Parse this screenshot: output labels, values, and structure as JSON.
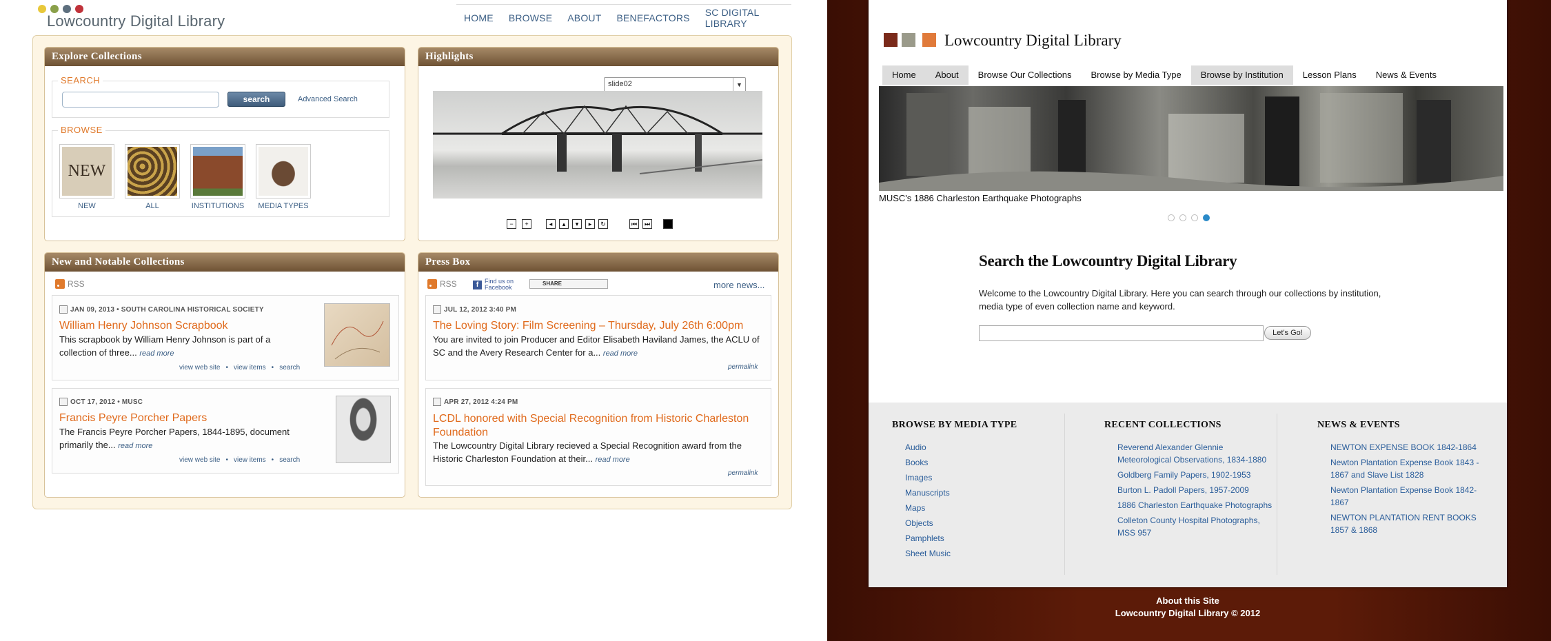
{
  "left": {
    "site_title": "Lowcountry Digital Library",
    "nav": [
      "HOME",
      "BROWSE",
      "ABOUT",
      "BENEFACTORS",
      "SC DIGITAL LIBRARY"
    ],
    "explore": {
      "heading": "Explore Collections",
      "search_label": "SEARCH",
      "search_button": "search",
      "advanced": "Advanced Search",
      "browse_label": "BROWSE",
      "thumbs": [
        "NEW",
        "ALL",
        "INSTITUTIONS",
        "MEDIA TYPES"
      ],
      "new_text": "NEW"
    },
    "highlights": {
      "heading": "Highlights",
      "slide_value": "slide02"
    },
    "notable": {
      "heading": "New and Notable Collections",
      "rss": "RSS",
      "items": [
        {
          "meta": "JAN 09, 2013 • SOUTH CAROLINA HISTORICAL SOCIETY",
          "title": "William Henry Johnson Scrapbook",
          "text": "This scrapbook by William Henry Johnson is part of a collection of three...",
          "read_more": "read more",
          "links": [
            "view web site",
            "view items",
            "search"
          ]
        },
        {
          "meta": "OCT 17, 2012 • MUSC",
          "title": "Francis Peyre Porcher Papers",
          "text": "The Francis Peyre Porcher Papers, 1844-1895, document primarily the...",
          "read_more": "read more",
          "links": [
            "view web site",
            "view items",
            "search"
          ]
        }
      ]
    },
    "press": {
      "heading": "Press Box",
      "rss": "RSS",
      "facebook": "Find us on Facebook",
      "share": "SHARE",
      "more_news": "more news...",
      "items": [
        {
          "meta": "JUL 12, 2012 3:40 PM",
          "title": "The Loving Story: Film Screening – Thursday, July 26th 6:00pm",
          "text": "You are invited to join Producer and Editor Elisabeth Haviland James, the ACLU of SC and the Avery Research Center for a...",
          "read_more": "read more",
          "permalink": "permalink"
        },
        {
          "meta": "APR 27, 2012 4:24 PM",
          "title": "LCDL honored with Special Recognition from Historic Charleston Foundation",
          "text": "The Lowcountry Digital Library recieved a Special Recognition award from the Historic Charleston Foundation at their...",
          "read_more": "read more",
          "permalink": "permalink"
        }
      ]
    }
  },
  "right": {
    "site_title": "Lowcountry Digital Library",
    "nav": [
      "Home",
      "About",
      "Browse Our Collections",
      "Browse by Media Type",
      "Browse by Institution",
      "Lesson Plans",
      "News & Events"
    ],
    "caption": "MUSC's 1886 Charleston Earthquake Photographs",
    "search_heading": "Search the Lowcountry Digital Library",
    "search_desc": "Welcome to the Lowcountry Digital Library.  Here you can search through our collections by institution, media type of even collection name and keyword.",
    "go_button": "Let's Go!",
    "footer": {
      "media": {
        "heading": "BROWSE BY MEDIA TYPE",
        "items": [
          "Audio",
          "Books",
          "Images",
          "Manuscripts",
          "Maps",
          "Objects",
          "Pamphlets",
          "Sheet Music"
        ]
      },
      "recent": {
        "heading": "RECENT COLLECTIONS",
        "items": [
          "Reverend Alexander Glennie Meteorological Observations, 1834-1880",
          "Goldberg Family Papers, 1902-1953",
          "Burton L. Padoll Papers, 1957-2009",
          "1886 Charleston Earthquake Photographs",
          "Colleton County Hospital Photographs, MSS 957"
        ]
      },
      "news": {
        "heading": "NEWS & EVENTS",
        "items": [
          "NEWTON EXPENSE BOOK 1842-1864",
          "Newton Plantation Expense Book 1843 - 1867 and Slave List 1828",
          "Newton Plantation Expense Book 1842-1867",
          "NEWTON PLANTATION RENT BOOKS 1857 & 1868"
        ]
      }
    },
    "bottom": {
      "about": "About this Site",
      "copyright": "Lowcountry Digital Library © 2012"
    }
  }
}
